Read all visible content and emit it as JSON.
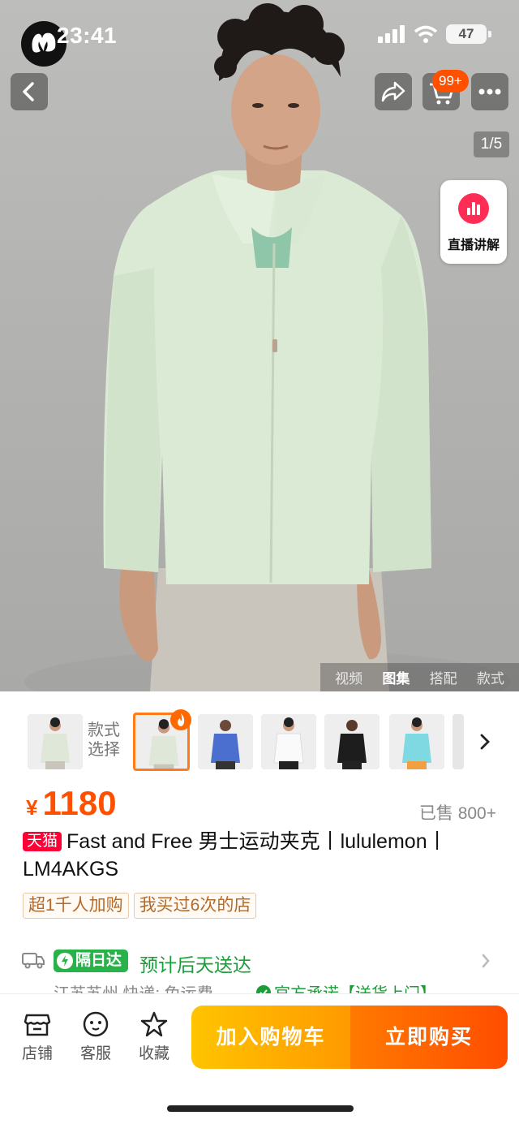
{
  "status_bar": {
    "time": "23:41",
    "battery": "47"
  },
  "header": {
    "cart_badge": "99+",
    "page_indicator": "1/5"
  },
  "live_card": {
    "label": "直播讲解"
  },
  "media_tabs": [
    {
      "label": "视频",
      "active": false
    },
    {
      "label": "图集",
      "active": true
    },
    {
      "label": "搭配",
      "active": false
    },
    {
      "label": "款式",
      "active": false
    }
  ],
  "style_selector": {
    "label": "款式选择"
  },
  "thumbnails": [
    {
      "color": "pale green",
      "swatch": "#dfe8d8"
    },
    {
      "color": "pale green",
      "swatch": "#dfe8d8",
      "selected": true
    },
    {
      "color": "blue",
      "swatch": "#4a6fcf"
    },
    {
      "color": "white",
      "swatch": "#f4f4f2"
    },
    {
      "color": "black",
      "swatch": "#1d1d1d"
    },
    {
      "color": "aqua",
      "swatch": "#7fd9e2"
    }
  ],
  "product": {
    "currency": "¥",
    "price": "1180",
    "sold": "已售 800+",
    "store_tag": "天猫",
    "title": "Fast and Free 男士运动夹克丨lululemon丨LM4AKGS",
    "tags": [
      "超1千人加购",
      "我买过6次的店"
    ]
  },
  "delivery": {
    "badge": "隔日达",
    "eta": "预计后天送达",
    "sub": "江苏苏州  快递: 免运费",
    "guarantee": "官方承诺【送货上门】"
  },
  "bottom_bar": {
    "shop": "店铺",
    "service": "客服",
    "favorite": "收藏",
    "add_to_cart": "加入购物车",
    "buy_now": "立即购买"
  },
  "colors": {
    "accent": "#ff5000",
    "express_green": "#2ab24a",
    "tmall_red": "#ff0036"
  }
}
